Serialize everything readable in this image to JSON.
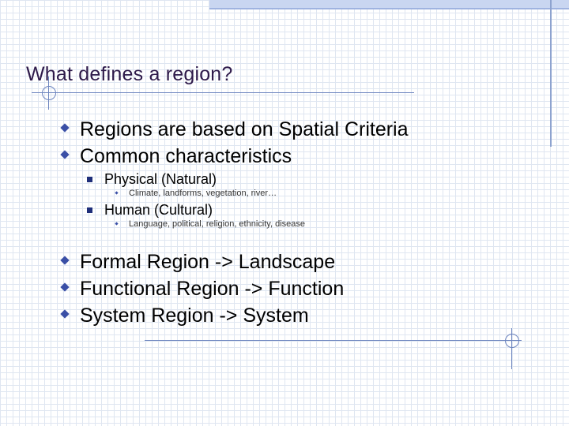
{
  "title": "What defines a region?",
  "bullets_top": [
    "Regions are based on Spatial Criteria",
    "Common characteristics"
  ],
  "characteristics": [
    {
      "label": "Physical (Natural)",
      "detail": "Climate, landforms, vegetation, river…"
    },
    {
      "label": "Human (Cultural)",
      "detail": "Language, political, religion, ethnicity, disease"
    }
  ],
  "bullets_bottom": [
    "Formal Region -> Landscape",
    "Functional Region -> Function",
    "System Region -> System"
  ],
  "colors": {
    "title": "#2e1a4a",
    "bullet_accent": "#3a4fa6",
    "decor_line": "#6d85bf",
    "top_band": "#c9d6f1"
  }
}
